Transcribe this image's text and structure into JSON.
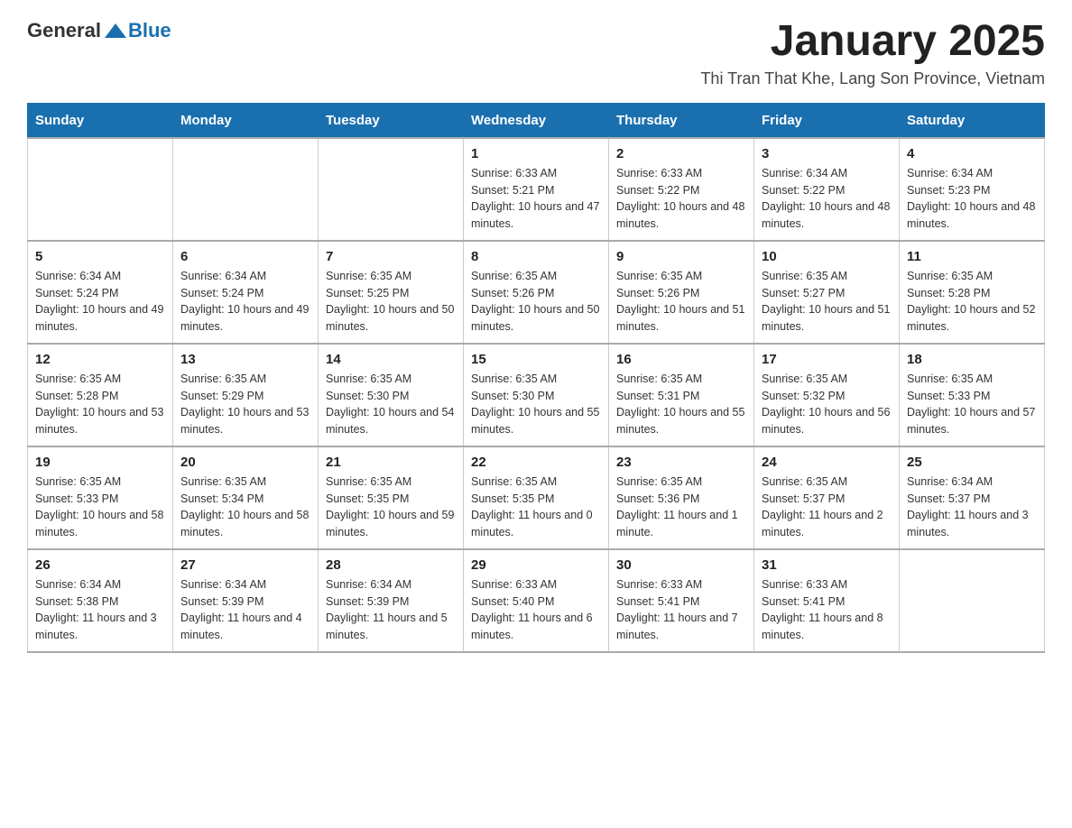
{
  "logo": {
    "general": "General",
    "blue": "Blue"
  },
  "title": "January 2025",
  "location": "Thi Tran That Khe, Lang Son Province, Vietnam",
  "headers": [
    "Sunday",
    "Monday",
    "Tuesday",
    "Wednesday",
    "Thursday",
    "Friday",
    "Saturday"
  ],
  "weeks": [
    [
      {
        "day": "",
        "info": ""
      },
      {
        "day": "",
        "info": ""
      },
      {
        "day": "",
        "info": ""
      },
      {
        "day": "1",
        "info": "Sunrise: 6:33 AM\nSunset: 5:21 PM\nDaylight: 10 hours and 47 minutes."
      },
      {
        "day": "2",
        "info": "Sunrise: 6:33 AM\nSunset: 5:22 PM\nDaylight: 10 hours and 48 minutes."
      },
      {
        "day": "3",
        "info": "Sunrise: 6:34 AM\nSunset: 5:22 PM\nDaylight: 10 hours and 48 minutes."
      },
      {
        "day": "4",
        "info": "Sunrise: 6:34 AM\nSunset: 5:23 PM\nDaylight: 10 hours and 48 minutes."
      }
    ],
    [
      {
        "day": "5",
        "info": "Sunrise: 6:34 AM\nSunset: 5:24 PM\nDaylight: 10 hours and 49 minutes."
      },
      {
        "day": "6",
        "info": "Sunrise: 6:34 AM\nSunset: 5:24 PM\nDaylight: 10 hours and 49 minutes."
      },
      {
        "day": "7",
        "info": "Sunrise: 6:35 AM\nSunset: 5:25 PM\nDaylight: 10 hours and 50 minutes."
      },
      {
        "day": "8",
        "info": "Sunrise: 6:35 AM\nSunset: 5:26 PM\nDaylight: 10 hours and 50 minutes."
      },
      {
        "day": "9",
        "info": "Sunrise: 6:35 AM\nSunset: 5:26 PM\nDaylight: 10 hours and 51 minutes."
      },
      {
        "day": "10",
        "info": "Sunrise: 6:35 AM\nSunset: 5:27 PM\nDaylight: 10 hours and 51 minutes."
      },
      {
        "day": "11",
        "info": "Sunrise: 6:35 AM\nSunset: 5:28 PM\nDaylight: 10 hours and 52 minutes."
      }
    ],
    [
      {
        "day": "12",
        "info": "Sunrise: 6:35 AM\nSunset: 5:28 PM\nDaylight: 10 hours and 53 minutes."
      },
      {
        "day": "13",
        "info": "Sunrise: 6:35 AM\nSunset: 5:29 PM\nDaylight: 10 hours and 53 minutes."
      },
      {
        "day": "14",
        "info": "Sunrise: 6:35 AM\nSunset: 5:30 PM\nDaylight: 10 hours and 54 minutes."
      },
      {
        "day": "15",
        "info": "Sunrise: 6:35 AM\nSunset: 5:30 PM\nDaylight: 10 hours and 55 minutes."
      },
      {
        "day": "16",
        "info": "Sunrise: 6:35 AM\nSunset: 5:31 PM\nDaylight: 10 hours and 55 minutes."
      },
      {
        "day": "17",
        "info": "Sunrise: 6:35 AM\nSunset: 5:32 PM\nDaylight: 10 hours and 56 minutes."
      },
      {
        "day": "18",
        "info": "Sunrise: 6:35 AM\nSunset: 5:33 PM\nDaylight: 10 hours and 57 minutes."
      }
    ],
    [
      {
        "day": "19",
        "info": "Sunrise: 6:35 AM\nSunset: 5:33 PM\nDaylight: 10 hours and 58 minutes."
      },
      {
        "day": "20",
        "info": "Sunrise: 6:35 AM\nSunset: 5:34 PM\nDaylight: 10 hours and 58 minutes."
      },
      {
        "day": "21",
        "info": "Sunrise: 6:35 AM\nSunset: 5:35 PM\nDaylight: 10 hours and 59 minutes."
      },
      {
        "day": "22",
        "info": "Sunrise: 6:35 AM\nSunset: 5:35 PM\nDaylight: 11 hours and 0 minutes."
      },
      {
        "day": "23",
        "info": "Sunrise: 6:35 AM\nSunset: 5:36 PM\nDaylight: 11 hours and 1 minute."
      },
      {
        "day": "24",
        "info": "Sunrise: 6:35 AM\nSunset: 5:37 PM\nDaylight: 11 hours and 2 minutes."
      },
      {
        "day": "25",
        "info": "Sunrise: 6:34 AM\nSunset: 5:37 PM\nDaylight: 11 hours and 3 minutes."
      }
    ],
    [
      {
        "day": "26",
        "info": "Sunrise: 6:34 AM\nSunset: 5:38 PM\nDaylight: 11 hours and 3 minutes."
      },
      {
        "day": "27",
        "info": "Sunrise: 6:34 AM\nSunset: 5:39 PM\nDaylight: 11 hours and 4 minutes."
      },
      {
        "day": "28",
        "info": "Sunrise: 6:34 AM\nSunset: 5:39 PM\nDaylight: 11 hours and 5 minutes."
      },
      {
        "day": "29",
        "info": "Sunrise: 6:33 AM\nSunset: 5:40 PM\nDaylight: 11 hours and 6 minutes."
      },
      {
        "day": "30",
        "info": "Sunrise: 6:33 AM\nSunset: 5:41 PM\nDaylight: 11 hours and 7 minutes."
      },
      {
        "day": "31",
        "info": "Sunrise: 6:33 AM\nSunset: 5:41 PM\nDaylight: 11 hours and 8 minutes."
      },
      {
        "day": "",
        "info": ""
      }
    ]
  ]
}
